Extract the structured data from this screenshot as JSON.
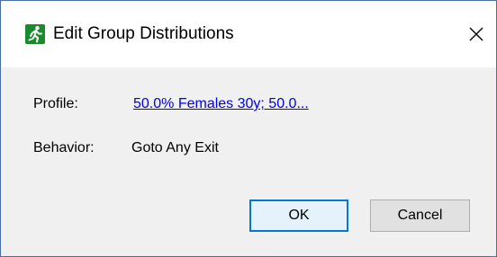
{
  "window": {
    "title": "Edit Group Distributions",
    "app_icon": "running-man-exit-icon",
    "close_icon": "close-icon"
  },
  "form": {
    "profile_label": "Profile:",
    "profile_value": "50.0% Females 30y; 50.0...",
    "behavior_label": "Behavior:",
    "behavior_value": "Goto Any Exit"
  },
  "buttons": {
    "ok_label": "OK",
    "cancel_label": "Cancel"
  },
  "colors": {
    "link": "#0000ee",
    "accent": "#0078d7",
    "icon_bg": "#1b8a2e"
  }
}
